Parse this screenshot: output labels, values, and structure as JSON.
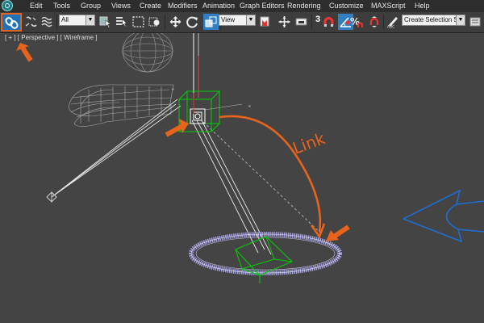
{
  "menu": {
    "items": [
      "Edit",
      "Tools",
      "Group",
      "Views",
      "Create",
      "Modifiers",
      "Animation",
      "Graph Editors",
      "Rendering",
      "Customize",
      "MAXScript",
      "Help"
    ]
  },
  "toolbar": {
    "selection_filter": "All",
    "reference_coordinate_system": "View",
    "snaps_toggle_label": "3",
    "named_selection_set": "Create Selection Se"
  },
  "viewport": {
    "label": "[ + ] [ Perspective ] [ Wireframe ]"
  },
  "annotations": {
    "link_text": "Link"
  },
  "colors": {
    "accent_orange": "#e8631c",
    "active_button_blue": "#1e73b8",
    "selection_green": "#00d000",
    "torus_purple": "#a4a0e6",
    "arrow_blue": "#1f6fcf",
    "viewport_bg": "#444444"
  },
  "icons": [
    "select-and-link-icon",
    "unlink-icon",
    "bind-space-warp-icon",
    "select-object-icon",
    "select-by-name-icon",
    "rectangular-selection-icon",
    "window-crossing-icon",
    "select-and-move-icon",
    "select-and-rotate-icon",
    "select-and-scale-icon",
    "use-pivot-center-icon",
    "select-and-manipulate-icon",
    "keyboard-shortcut-override-icon",
    "snaps-toggle-icon",
    "angle-snap-icon",
    "percent-snap-icon",
    "spinner-snap-icon",
    "edit-named-selection-icon"
  ]
}
